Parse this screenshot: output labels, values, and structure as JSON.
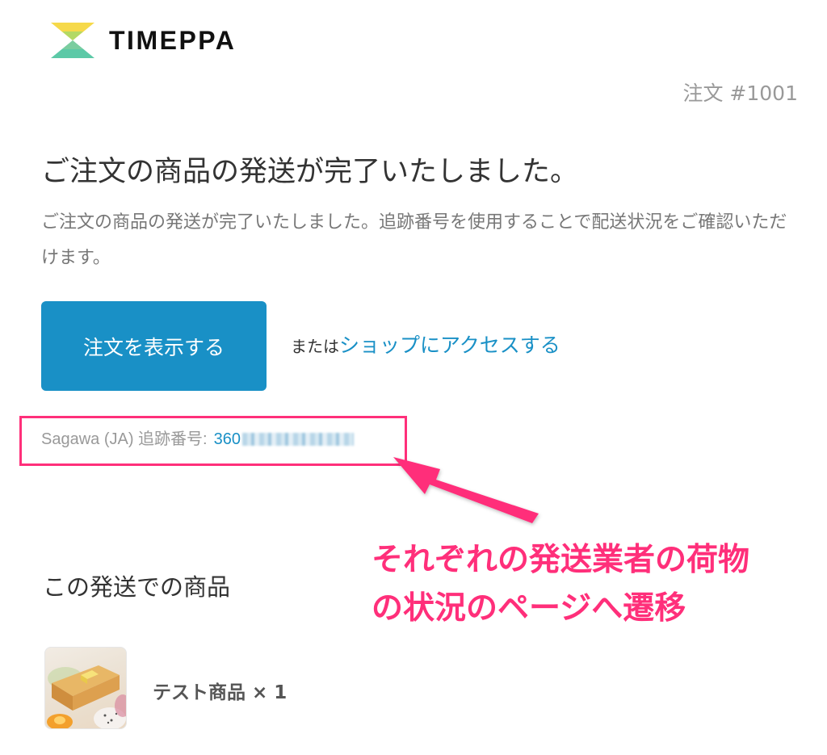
{
  "brand": {
    "name": "TIMEPPA",
    "colors": {
      "top": "#f6d94a",
      "bottom": "#5cc9a7"
    }
  },
  "order": {
    "number": "注文 #1001"
  },
  "email": {
    "heading": "ご注文の商品の発送が完了いたしました。",
    "description": "ご注文の商品の発送が完了いたしました。追跡番号を使用することで配送状況をご確認いただけます。",
    "view_order_button": "注文を表示する",
    "or_text": "または",
    "shop_link": "ショップにアクセスする"
  },
  "tracking": {
    "label": "Sagawa (JA) 追跡番号:",
    "number_visible": "360"
  },
  "annotation": {
    "line1": "それぞれの発送業者の荷物",
    "line2": "の状況のページへ遷移",
    "color": "#ff2f7a"
  },
  "items_section": {
    "title": "この発送での商品",
    "items": [
      {
        "name": "テスト商品",
        "quantity": "× 1"
      }
    ]
  },
  "colors": {
    "accent": "#1990c6",
    "muted": "#999999",
    "annotation": "#ff2f7a"
  }
}
